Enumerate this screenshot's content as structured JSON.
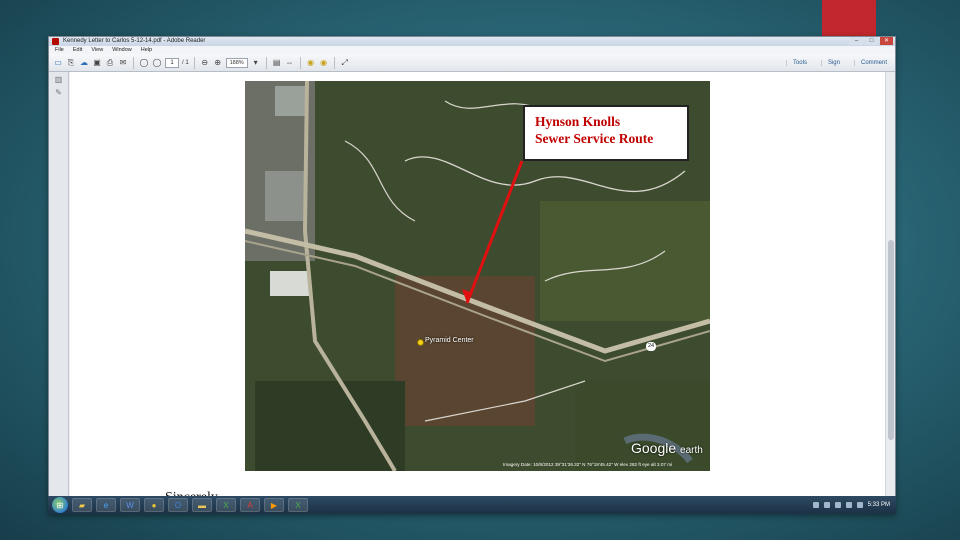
{
  "window": {
    "title": "Kennedy Letter to Carlos 5-12-14.pdf - Adobe Reader",
    "controls": {
      "minimize": "–",
      "maximize": "□",
      "close": "✕"
    }
  },
  "menu": [
    "File",
    "Edit",
    "View",
    "Window",
    "Help"
  ],
  "toolbar": {
    "page_current": "1",
    "page_total": "/ 1",
    "zoom": "188%",
    "right": [
      "Tools",
      "Sign",
      "Comment"
    ]
  },
  "map": {
    "callout_line1": "Hynson Knolls",
    "callout_line2": "Sewer Service Route",
    "place_label": "Pyramid Center",
    "highway_shield": "24",
    "logo_google": "Google",
    "logo_earth": "earth",
    "imagery_text": "Imagery Date: 10/6/2012     39°31'36.32\" N  76°19'45.42\" W  elev  282 ft     eye alt  3.07 mi"
  },
  "document": {
    "closing": "Sincerely,"
  },
  "taskbar": {
    "clock": "5:33 PM",
    "apps": [
      "explorer-icon",
      "ie-icon",
      "word-icon",
      "chrome-icon",
      "outlook-icon",
      "folder-icon",
      "excel-icon",
      "acrobat-icon",
      "media-icon",
      "excel-icon-2"
    ]
  },
  "colors": {
    "accent_red": "#c1272d",
    "callout_text": "#c00000",
    "route_arrow": "#e01010"
  }
}
